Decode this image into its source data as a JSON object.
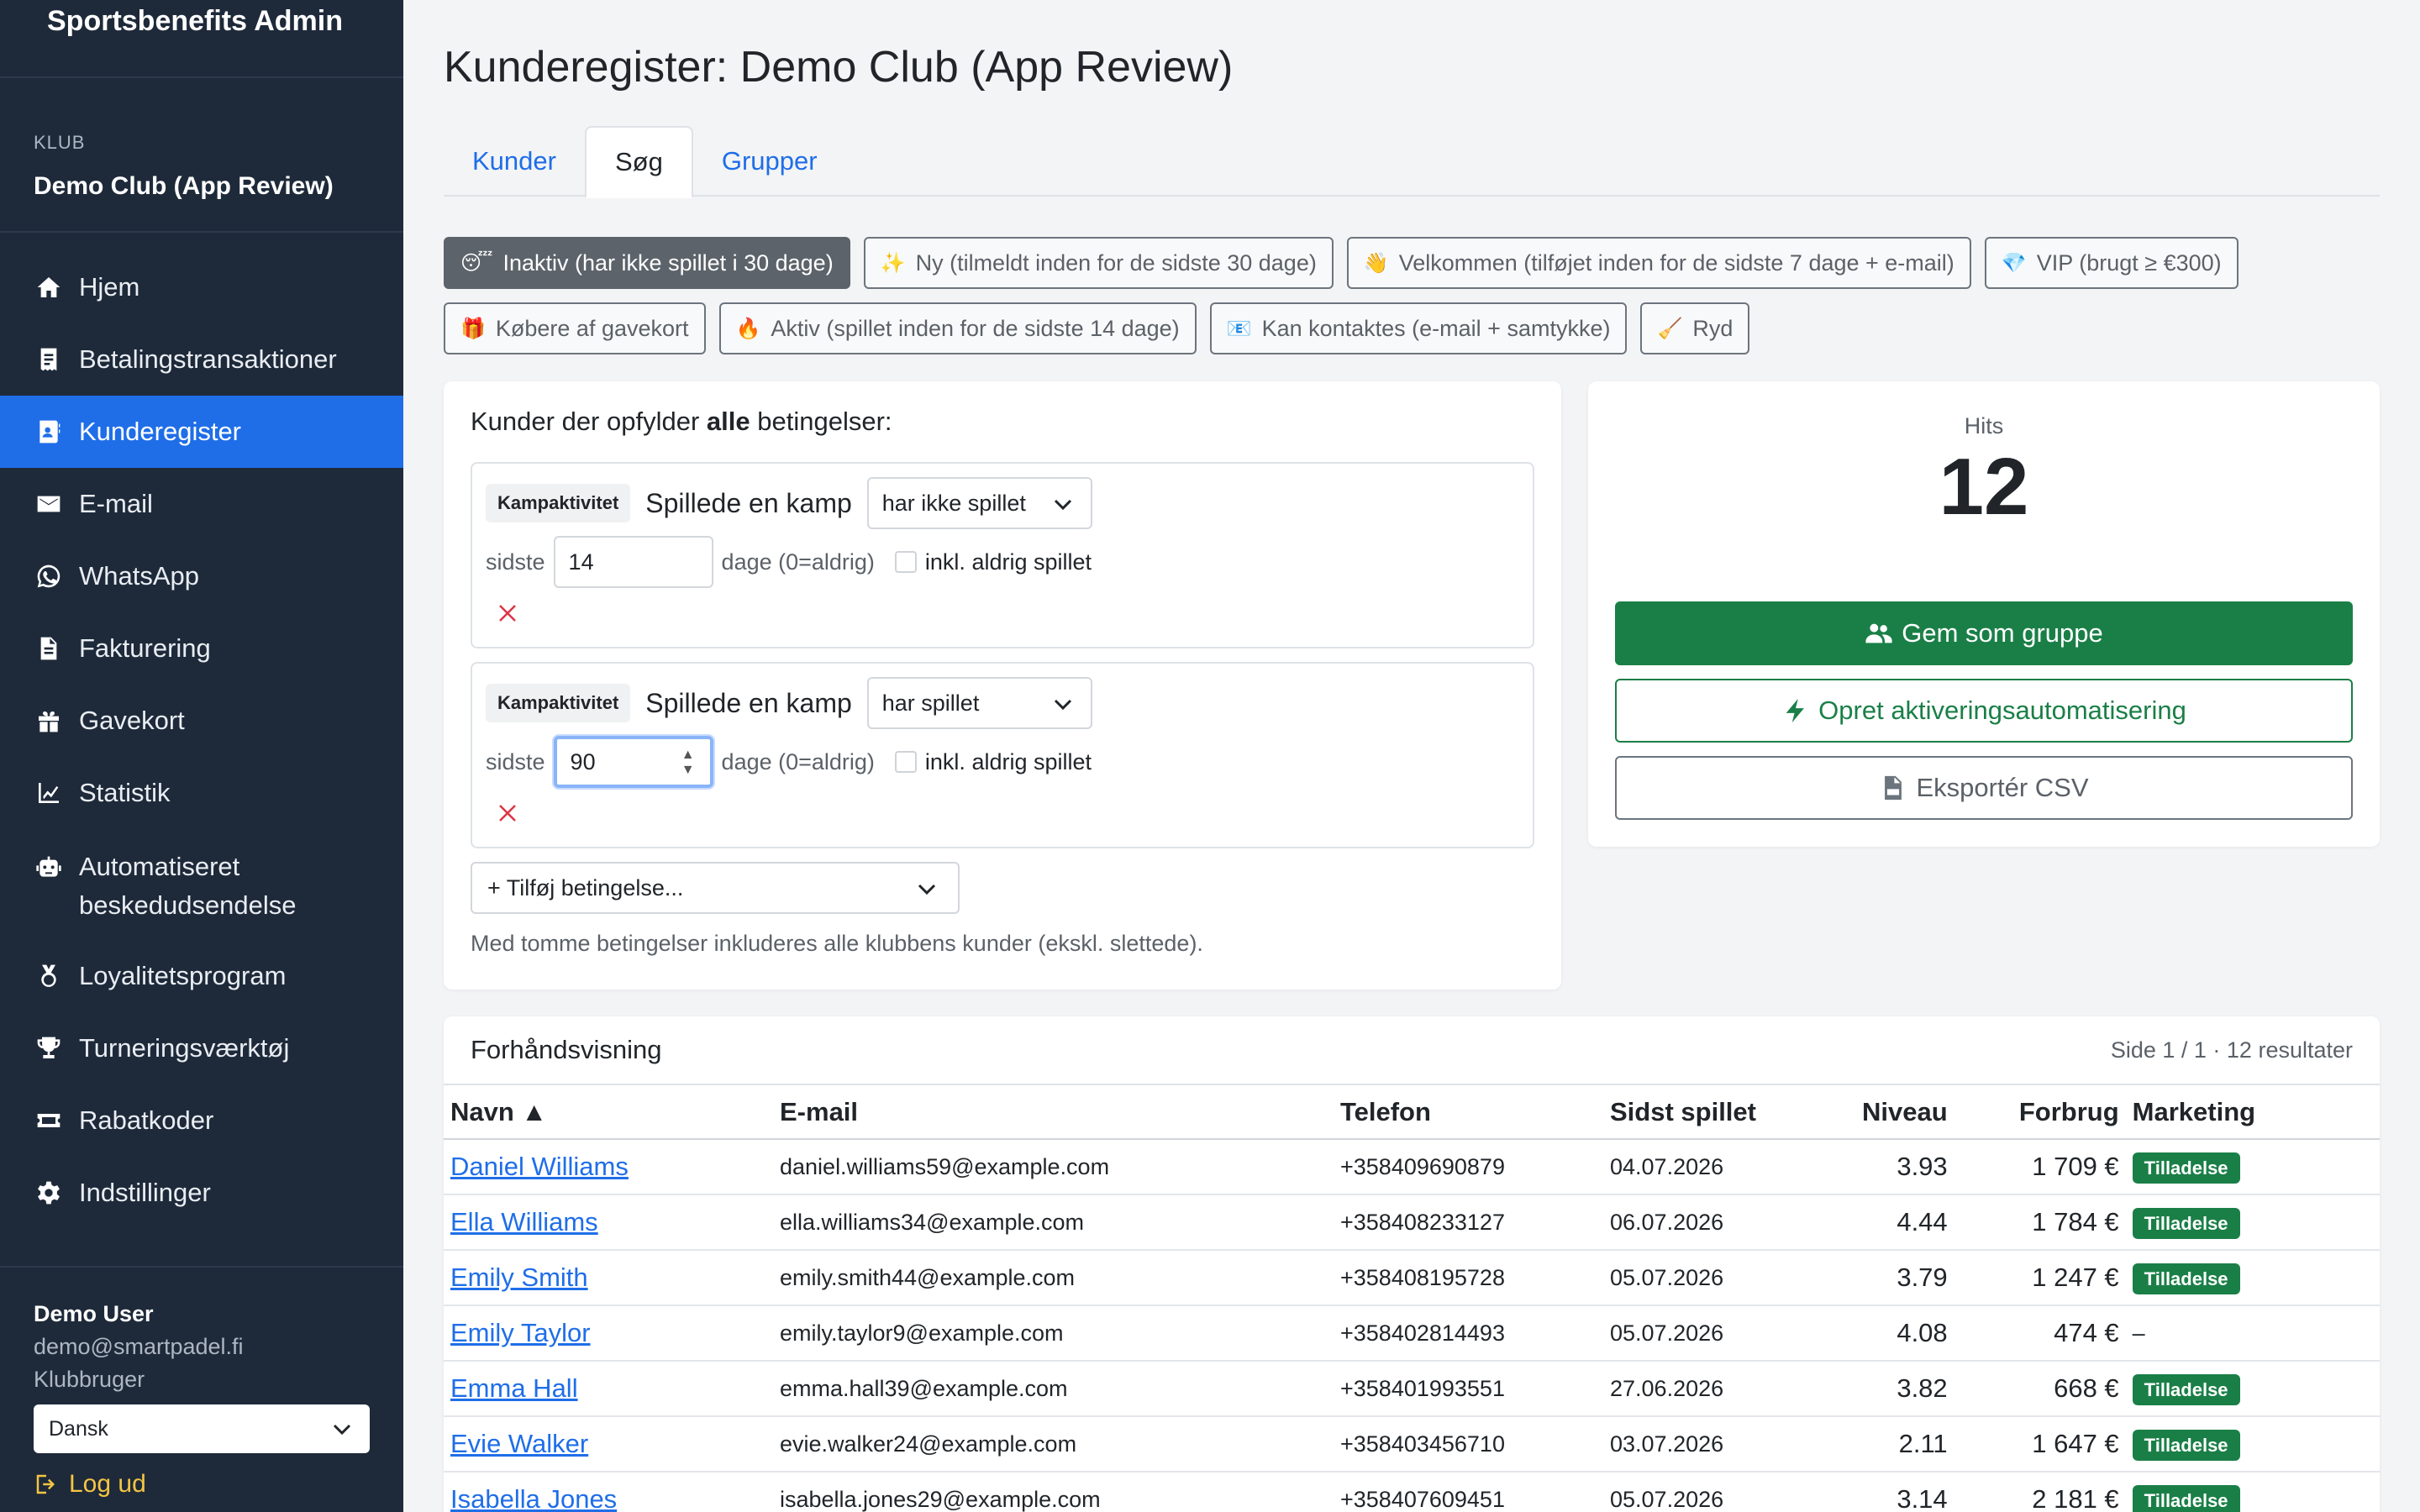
{
  "app": {
    "title": "Sportsbenefits Admin"
  },
  "club": {
    "label": "KLUB",
    "name": "Demo Club (App Review)"
  },
  "nav": [
    {
      "label": "Hjem",
      "icon": "home-icon"
    },
    {
      "label": "Betalingstransaktioner",
      "icon": "receipt-icon"
    },
    {
      "label": "Kunderegister",
      "icon": "contact-card-icon",
      "active": true
    },
    {
      "label": "E-mail",
      "icon": "envelope-icon"
    },
    {
      "label": "WhatsApp",
      "icon": "whatsapp-icon"
    },
    {
      "label": "Fakturering",
      "icon": "invoice-icon"
    },
    {
      "label": "Gavekort",
      "icon": "gift-icon"
    },
    {
      "label": "Statistik",
      "icon": "chart-line-icon"
    },
    {
      "label": "Automatiseret beskedudsendelse",
      "icon": "robot-icon"
    },
    {
      "label": "Loyalitetsprogram",
      "icon": "medal-icon"
    },
    {
      "label": "Turneringsværktøj",
      "icon": "trophy-icon"
    },
    {
      "label": "Rabatkoder",
      "icon": "ticket-icon"
    },
    {
      "label": "Indstillinger",
      "icon": "gear-icon"
    }
  ],
  "user": {
    "name": "Demo User",
    "email": "demo@smartpadel.fi",
    "role": "Klubbruger",
    "language": "Dansk",
    "logout": "Log ud"
  },
  "page": {
    "title": "Kunderegister: Demo Club (App Review)"
  },
  "tabs": [
    {
      "label": "Kunder"
    },
    {
      "label": "Søg",
      "active": true
    },
    {
      "label": "Grupper"
    }
  ],
  "presets": [
    {
      "emoji": "😴",
      "label": "Inaktiv (har ikke spillet i 30 dage)",
      "active": true
    },
    {
      "emoji": "✨",
      "label": "Ny (tilmeldt inden for de sidste 30 dage)"
    },
    {
      "emoji": "👋",
      "label": "Velkommen (tilføjet inden for de sidste 7 dage + e-mail)"
    },
    {
      "emoji": "💎",
      "label": "VIP (brugt ≥ €300)"
    },
    {
      "emoji": "🎁",
      "label": "Købere af gavekort"
    },
    {
      "emoji": "🔥",
      "label": "Aktiv (spillet inden for de sidste 14 dage)"
    },
    {
      "emoji": "📧",
      "label": "Kan kontaktes (e-mail + samtykke)"
    },
    {
      "emoji": "🧹",
      "label": "Ryd"
    }
  ],
  "conditions": {
    "heading_pre": "Kunder der opfylder",
    "heading_bold": "alle",
    "heading_post": "betingelser:",
    "items": [
      {
        "category": "Kampaktivitet",
        "field": "Spillede en kamp",
        "operator": "har ikke spillet",
        "last_label": "sidste",
        "days": "14",
        "days_suffix": "dage (0=aldrig)",
        "include_never": "inkl. aldrig spillet"
      },
      {
        "category": "Kampaktivitet",
        "field": "Spillede en kamp",
        "operator": "har spillet",
        "last_label": "sidste",
        "days": "90",
        "days_suffix": "dage (0=aldrig)",
        "include_never": "inkl. aldrig spillet"
      }
    ],
    "add_label": "+ Tilføj betingelse...",
    "hint": "Med tomme betingelser inkluderes alle klubbens kunder (ekskl. slettede)."
  },
  "hits": {
    "label": "Hits",
    "value": "12",
    "save_group": "Gem som gruppe",
    "create_automation": "Opret aktiveringsautomatisering",
    "export_csv": "Eksportér CSV"
  },
  "preview": {
    "title": "Forhåndsvisning",
    "meta": "Side 1 / 1 · 12 resultater",
    "columns": [
      "Navn ▲",
      "E-mail",
      "Telefon",
      "Sidst spillet",
      "Niveau",
      "Forbrug",
      "Marketing"
    ],
    "rows": [
      {
        "name": "Daniel Williams",
        "email": "daniel.williams59@example.com",
        "phone": "+358409690879",
        "last_played": "04.07.2026",
        "level": "3.93",
        "spend": "1 709 €",
        "marketing": "Tilladelse"
      },
      {
        "name": "Ella Williams",
        "email": "ella.williams34@example.com",
        "phone": "+358408233127",
        "last_played": "06.07.2026",
        "level": "4.44",
        "spend": "1 784 €",
        "marketing": "Tilladelse"
      },
      {
        "name": "Emily Smith",
        "email": "emily.smith44@example.com",
        "phone": "+358408195728",
        "last_played": "05.07.2026",
        "level": "3.79",
        "spend": "1 247 €",
        "marketing": "Tilladelse"
      },
      {
        "name": "Emily Taylor",
        "email": "emily.taylor9@example.com",
        "phone": "+358402814493",
        "last_played": "05.07.2026",
        "level": "4.08",
        "spend": "474 €",
        "marketing": "–"
      },
      {
        "name": "Emma Hall",
        "email": "emma.hall39@example.com",
        "phone": "+358401993551",
        "last_played": "27.06.2026",
        "level": "3.82",
        "spend": "668 €",
        "marketing": "Tilladelse"
      },
      {
        "name": "Evie Walker",
        "email": "evie.walker24@example.com",
        "phone": "+358403456710",
        "last_played": "03.07.2026",
        "level": "2.11",
        "spend": "1 647 €",
        "marketing": "Tilladelse"
      },
      {
        "name": "Isabella Jones",
        "email": "isabella.jones29@example.com",
        "phone": "+358407609451",
        "last_played": "05.07.2026",
        "level": "3.14",
        "spend": "2 181 €",
        "marketing": "Tilladelse"
      }
    ]
  }
}
